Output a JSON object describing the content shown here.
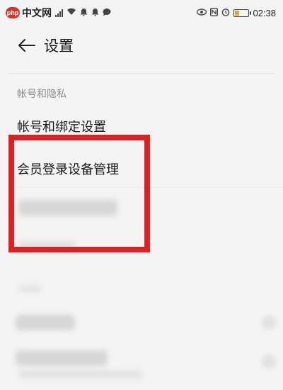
{
  "status_bar": {
    "watermark_badge": "php",
    "watermark_site": "中文网",
    "time": "02:38",
    "battery_level": 0.28,
    "left_icons": [
      "signal-bars-icon",
      "wifi-icon",
      "notification-icon",
      "notification-icon",
      "chat-bubble-icon"
    ],
    "right_icons": [
      "eye-icon",
      "nfc-icon",
      "alarm-icon",
      "battery-icon"
    ]
  },
  "header": {
    "title": "设置",
    "back_icon": "arrow-left-icon"
  },
  "section": {
    "title": "帐号和隐私",
    "items": [
      {
        "label": "帐号和绑定设置"
      },
      {
        "label": "会员登录设备管理"
      }
    ]
  },
  "colors": {
    "background": "#f4f4f4",
    "highlight": "#e02020",
    "section_header": "#8a8a8a",
    "watermark": "#d6332a"
  }
}
